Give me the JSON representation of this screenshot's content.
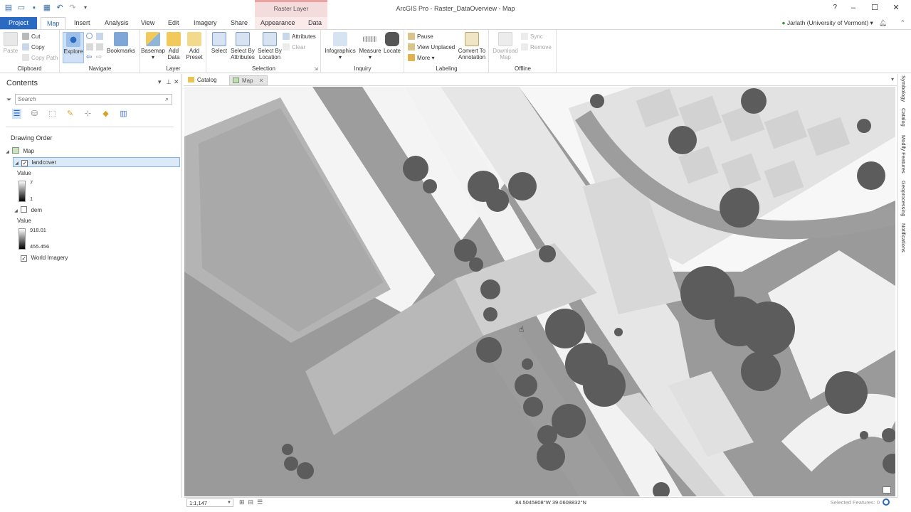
{
  "window": {
    "title": "ArcGIS Pro - Raster_DataOverview - Map",
    "help": "?",
    "minimize": "–",
    "maximize": "☐",
    "close": "✕"
  },
  "contextual_header": "Raster Layer",
  "tabs": [
    "Project",
    "Map",
    "Insert",
    "Analysis",
    "View",
    "Edit",
    "Imagery",
    "Share",
    "Appearance",
    "Data"
  ],
  "user": {
    "name": "Jarlath (University of Vermont)",
    "status_icon": "signed-in-icon",
    "notifications_icon": "bell-icon"
  },
  "ribbon": {
    "clipboard": {
      "label": "Clipboard",
      "paste": "Paste",
      "cut": "Cut",
      "copy": "Copy",
      "copy_path": "Copy Path"
    },
    "navigate": {
      "label": "Navigate",
      "explore": "Explore",
      "bookmarks": "Bookmarks"
    },
    "layer": {
      "label": "Layer",
      "basemap": "Basemap",
      "add_data_1": "Add",
      "add_data_2": "Data",
      "add_preset_1": "Add",
      "add_preset_2": "Preset"
    },
    "selection": {
      "label": "Selection",
      "select": "Select",
      "by_attributes_1": "Select By",
      "by_attributes_2": "Attributes",
      "by_location_1": "Select By",
      "by_location_2": "Location",
      "attributes": "Attributes",
      "clear": "Clear"
    },
    "inquiry": {
      "label": "Inquiry",
      "infographics": "Infographics",
      "measure": "Measure",
      "locate": "Locate"
    },
    "labeling": {
      "label": "Labeling",
      "pause": "Pause",
      "view_unplaced": "View Unplaced",
      "more": "More",
      "convert_1": "Convert To",
      "convert_2": "Annotation"
    },
    "offline": {
      "label": "Offline",
      "download_1": "Download",
      "download_2": "Map",
      "sync": "Sync",
      "remove": "Remove"
    }
  },
  "contents": {
    "title": "Contents",
    "search_placeholder": "Search",
    "drawing_order": "Drawing Order",
    "map_label": "Map",
    "layers": [
      {
        "name": "landcover",
        "checked": true,
        "value_label": "Value",
        "max": "7",
        "min": "1"
      },
      {
        "name": "dem",
        "checked": false,
        "value_label": "Value",
        "max": "918.01",
        "min": "455.456"
      },
      {
        "name": "World Imagery",
        "checked": true
      }
    ]
  },
  "map_tabs": [
    "Catalog",
    "Map"
  ],
  "statusbar": {
    "scale": "1:1,147",
    "coordinates": "84.5045808°W 39.0608832°N",
    "selected_features": "Selected Features: 0"
  },
  "right_dock": [
    "Symbology",
    "Catalog",
    "Modify Features",
    "Geoprocessing",
    "Notifications"
  ],
  "colors": {
    "accent": "#2a6ac2",
    "landcover_dark": "#5a5a5a",
    "landcover_mid": "#7e7e7e",
    "landcover_light": "#d6d6d6",
    "landcover_white": "#f7f7f7"
  }
}
